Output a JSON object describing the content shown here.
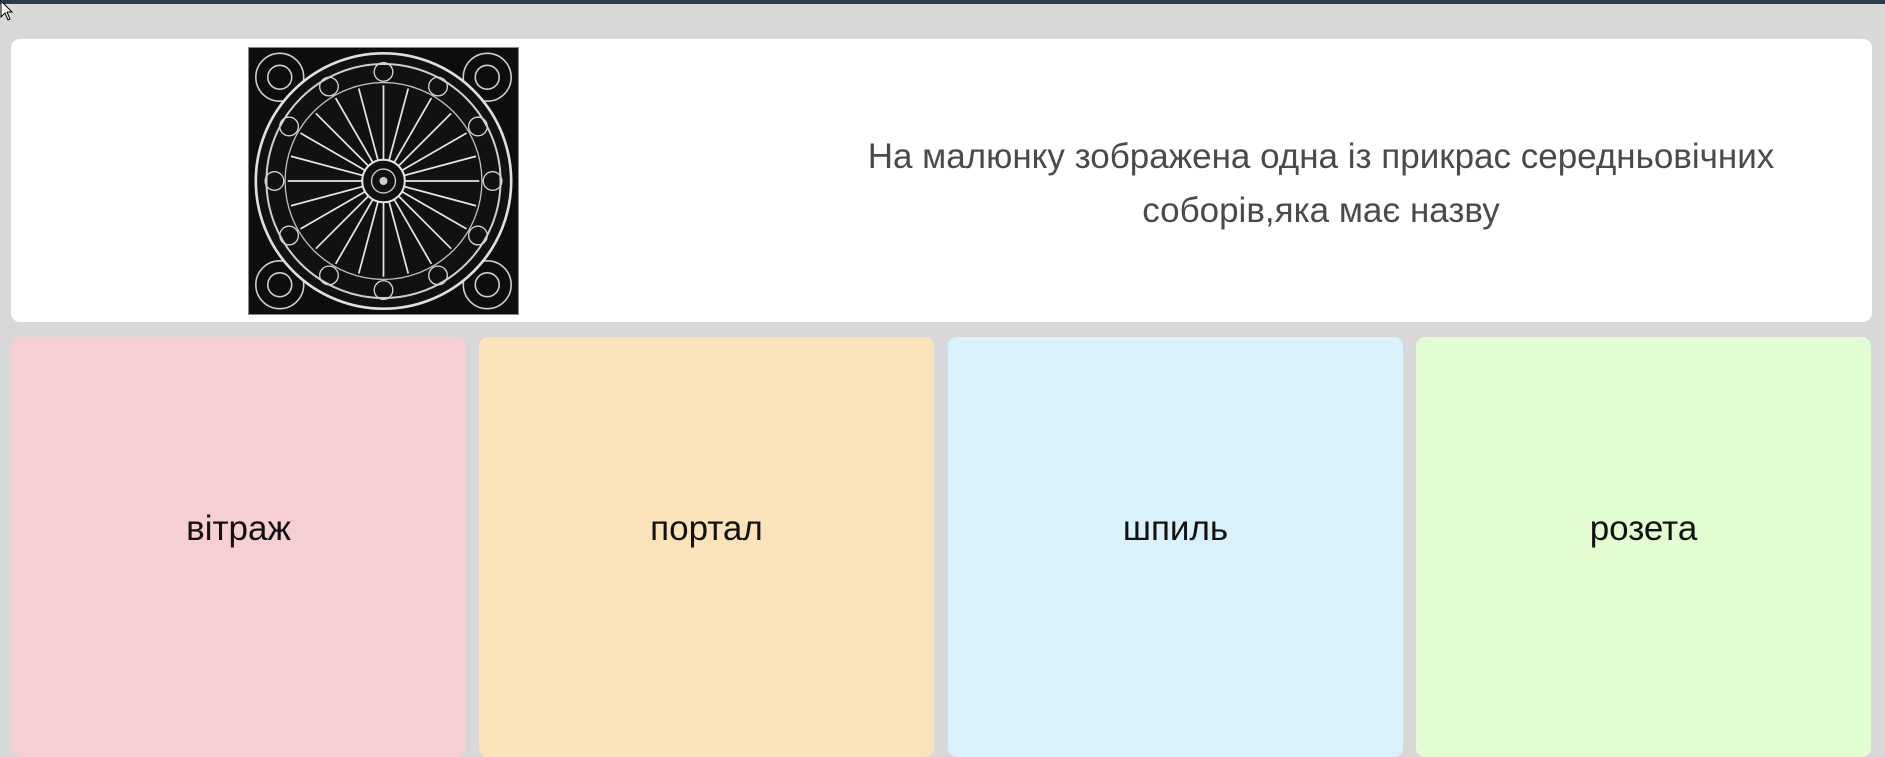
{
  "question": {
    "text": "На малюнку зображена одна із прикрас середньовічних соборів,яка має назву",
    "image_icon": "rose-window-image"
  },
  "answers": [
    {
      "label": "вітраж",
      "color": "#f6cfd2"
    },
    {
      "label": "портал",
      "color": "#fbe3b9"
    },
    {
      "label": "шпиль",
      "color": "#d8f1fb"
    },
    {
      "label": "розета",
      "color": "#e2fdd1"
    }
  ],
  "colors": {
    "background": "#d8d8d8",
    "card": "#ffffff",
    "question_text": "#4a4a4a",
    "top_strip": "#2b3b4e"
  }
}
